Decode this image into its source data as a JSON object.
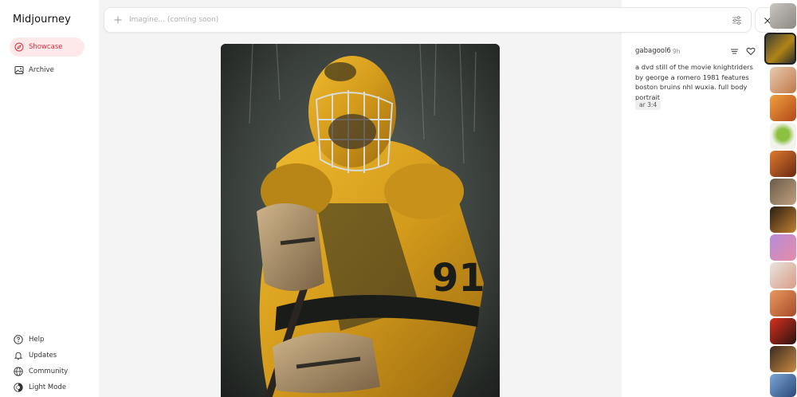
{
  "app": {
    "title": "Midjourney"
  },
  "sidebar": {
    "nav": [
      {
        "label": "Showcase",
        "icon": "compass-icon",
        "active": true
      },
      {
        "label": "Archive",
        "icon": "image-icon",
        "active": false
      }
    ],
    "footer": [
      {
        "label": "Help",
        "icon": "help-circle-icon"
      },
      {
        "label": "Updates",
        "icon": "bell-icon"
      },
      {
        "label": "Community",
        "icon": "globe-icon"
      },
      {
        "label": "Light Mode",
        "icon": "sun-moon-icon"
      }
    ]
  },
  "search": {
    "placeholder": "Imagine... (coming soon)"
  },
  "detail": {
    "author": "gabagool6",
    "time": "9h",
    "prompt": "a dvd still of the movie knightriders by george a romero 1981 features boston bruins nhl wuxia. full body portrait",
    "param": "ar 3:4"
  },
  "hero": {
    "jersey_number": "91"
  },
  "colors": {
    "accent": "#d6303f",
    "accent_bg": "#fde9ea",
    "jersey_gold": "#d9a320"
  }
}
